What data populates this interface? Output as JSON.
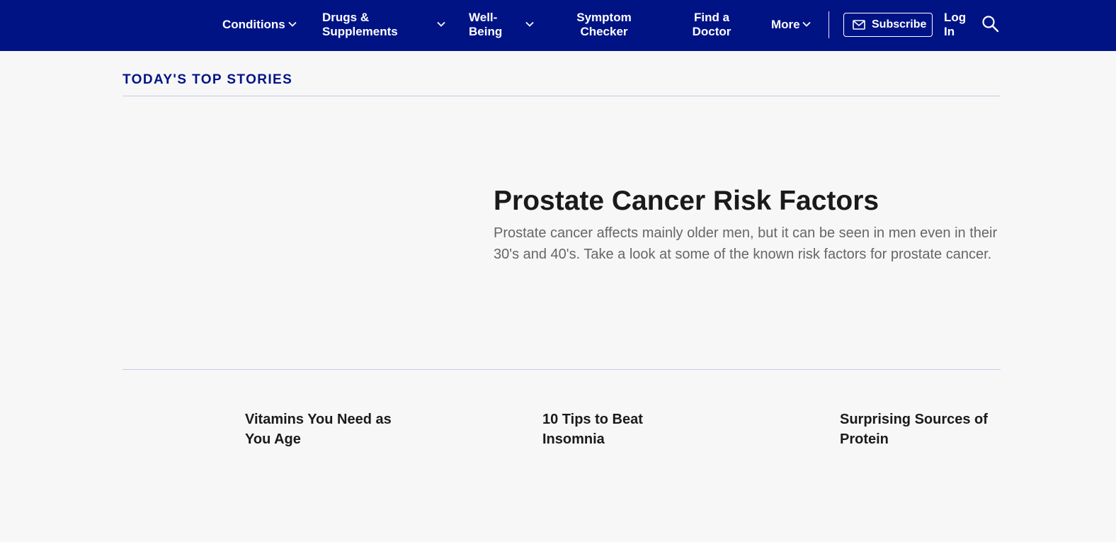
{
  "nav": {
    "conditions": "Conditions",
    "drugs_line1": "Drugs &",
    "drugs_line2": "Supplements",
    "wellbeing_line1": "Well-",
    "wellbeing_line2": "Being",
    "symptom_line1": "Symptom",
    "symptom_line2": "Checker",
    "doctor_line1": "Find a",
    "doctor_line2": "Doctor",
    "more": "More",
    "subscribe": "Subscribe",
    "login_line1": "Log",
    "login_line2": "In"
  },
  "icons": {
    "chevron": "chevron-down-icon",
    "mail": "mail-icon",
    "search": "search-icon"
  },
  "colors": {
    "nav_bg": "#001385",
    "section_title": "#001385",
    "divider": "#c6c9e3",
    "body_bg": "#f7f7f8"
  },
  "section": {
    "title": "TODAY'S TOP STORIES"
  },
  "hero": {
    "title": "Prostate Cancer Risk Factors",
    "description": "Prostate cancer affects mainly older men, but it can be seen in men even in their 30's and 40's. Take a look at some of the known risk factors for prostate cancer."
  },
  "stories": [
    {
      "line1": "Vitamins You Need as",
      "line2": "You Age"
    },
    {
      "line1": "10 Tips to Beat",
      "line2": "Insomnia"
    },
    {
      "line1": "Surprising Sources of",
      "line2": "Protein"
    }
  ]
}
